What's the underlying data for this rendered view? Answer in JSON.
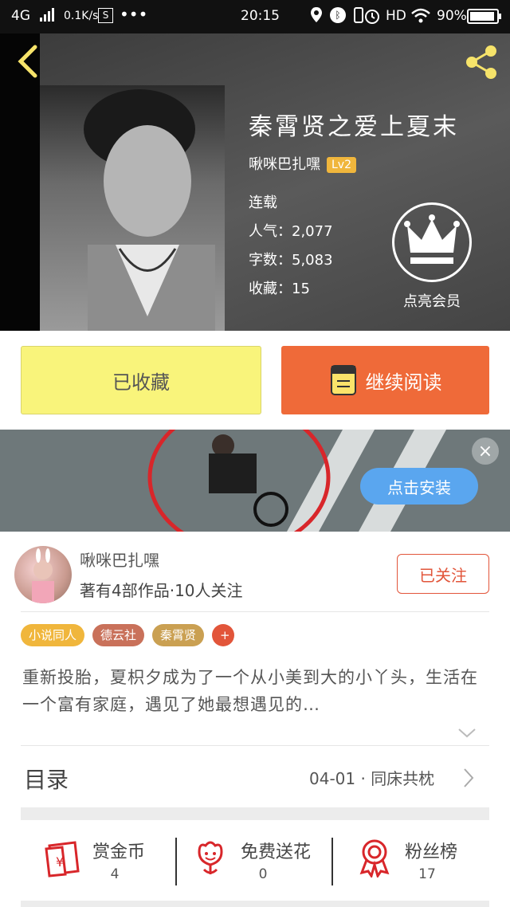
{
  "status_bar": {
    "network": "4G",
    "speed": "0.1K/s",
    "time": "20:15",
    "hd": "HD",
    "battery": "90%"
  },
  "book": {
    "title": "秦霄贤之爱上夏末",
    "author": "啾咪巴扎嘿",
    "level": "Lv2",
    "status": "连载",
    "popularity": "人气：2,077",
    "word_count": "字数：5,083",
    "favorites": "收藏：15",
    "vip_label": "点亮会员"
  },
  "actions": {
    "favorited_label": "已收藏",
    "continue_label": "继续阅读"
  },
  "ad": {
    "install_label": "点击安装",
    "close_label": "×"
  },
  "author_card": {
    "name": "啾咪巴扎嘿",
    "stats": "著有4部作品·10人关注",
    "follow_label": "已关注"
  },
  "tags": [
    {
      "label": "小说同人",
      "color": "#f0b63c"
    },
    {
      "label": "德云社",
      "color": "#c9715a"
    },
    {
      "label": "秦霄贤",
      "color": "#caa052"
    },
    {
      "label": "+",
      "color": "#e2553a"
    }
  ],
  "description": "重新投胎，夏枳夕成为了一个从小美到大的小丫头，生活在一个富有家庭，遇见了她最想遇见的…",
  "toc": {
    "label": "目录",
    "latest": "04-01 · 同床共枕"
  },
  "stats": [
    {
      "label": "赏金币",
      "value": "4",
      "icon": "red-envelope-icon"
    },
    {
      "label": "免费送花",
      "value": "0",
      "icon": "flower-icon"
    },
    {
      "label": "粉丝榜",
      "value": "17",
      "icon": "ribbon-badge-icon"
    }
  ]
}
